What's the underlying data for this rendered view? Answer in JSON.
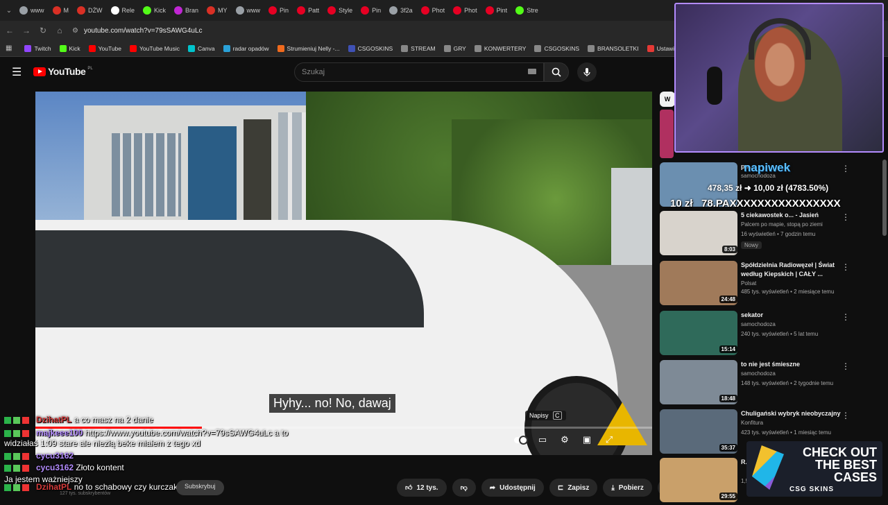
{
  "tabs": [
    {
      "label": "www",
      "color": "#9aa0a6"
    },
    {
      "label": "M",
      "color": "#d93025"
    },
    {
      "label": "DŻW",
      "color": "#d93025"
    },
    {
      "label": "Rele",
      "color": "#ffffff"
    },
    {
      "label": "Kick",
      "color": "#53fc18"
    },
    {
      "label": "Bran",
      "color": "#c026d3"
    },
    {
      "label": "MY",
      "color": "#d93025"
    },
    {
      "label": "www",
      "color": "#9aa0a6"
    },
    {
      "label": "Pin",
      "color": "#e60023"
    },
    {
      "label": "Patt",
      "color": "#e60023"
    },
    {
      "label": "Style",
      "color": "#e60023"
    },
    {
      "label": "Pin",
      "color": "#e60023"
    },
    {
      "label": "3f2a",
      "color": "#9aa0a6"
    },
    {
      "label": "Phot",
      "color": "#e60023"
    },
    {
      "label": "Phot",
      "color": "#e60023"
    },
    {
      "label": "Pint",
      "color": "#e60023"
    },
    {
      "label": "Stre",
      "color": "#53fc18"
    }
  ],
  "url": "youtube.com/watch?v=79sSAWG4uLc",
  "bookmarks": [
    {
      "label": "Twitch",
      "color": "#9146ff"
    },
    {
      "label": "Kick",
      "color": "#53fc18"
    },
    {
      "label": "YouTube",
      "color": "#ff0000"
    },
    {
      "label": "YouTube Music",
      "color": "#ff0000"
    },
    {
      "label": "Canva",
      "color": "#00c4cc"
    },
    {
      "label": "radar opadów",
      "color": "#2aa1d8"
    },
    {
      "label": "Strumieniuj Nelly -...",
      "color": "#f06a1d"
    },
    {
      "label": "CSGOSKINS",
      "color": "#3f51b5"
    },
    {
      "label": "STREAM",
      "color": "#888888"
    },
    {
      "label": "GRY",
      "color": "#888888"
    },
    {
      "label": "KONWERTERY",
      "color": "#888888"
    },
    {
      "label": "CSGOSKINS",
      "color": "#888888"
    },
    {
      "label": "BRANSOLETKI",
      "color": "#888888"
    },
    {
      "label": "Ustawienia strumien...",
      "color": "#e53935"
    }
  ],
  "yt": {
    "logo": "YouTube",
    "region": "PL",
    "search_placeholder": "Szukaj"
  },
  "video": {
    "subtitle": "Hyhy... no! No, dawaj",
    "captions_tooltip": "Napisy",
    "captions_key": "C",
    "progress": 0.27
  },
  "chat": [
    {
      "user": "DzihatPL",
      "user_color": "#d63b3b",
      "text": "a co masz na 2 danie"
    },
    {
      "user": "majkeee100",
      "user_color": "#b48cff",
      "text": "https://www.youtube.com/watch?v=79sSAWG4uLc a to"
    },
    {
      "user": "",
      "user_color": "#ffffff",
      "text": "widziałaś 1:09 stare ale niezłą beke miałem z tego xd"
    },
    {
      "user": "cycu3162",
      "user_color": "#b48cff",
      "text": ""
    },
    {
      "user": "cycu3162",
      "user_color": "#b48cff",
      "text": "Złoto kontent"
    },
    {
      "user": "",
      "user_color": "#ffffff",
      "text": "Ja jestem ważniejszy"
    },
    {
      "user": "DzihatPL",
      "user_color": "#d63b3b",
      "text": "no to schabowy czy kurczak"
    }
  ],
  "channel_behind": {
    "subs": "127 tys. subskrybentów",
    "subscribe": "Subskrybuj"
  },
  "actions": {
    "likes": "12 tys.",
    "share": "Udostępnij",
    "save": "Zapisz",
    "download": "Pobierz"
  },
  "sidebar": [
    {
      "title": "po...",
      "channel": "samochodoza",
      "meta": "",
      "duration": "",
      "color": "#6b8fb0",
      "new": ""
    },
    {
      "title": "5 ciekawostek o... - Jasień",
      "channel": "Palcem po mapie, stopą po ziemi",
      "meta": "16 wyświetleń • 7 godzin temu",
      "duration": "8:03",
      "color": "#d8d3cc",
      "new": "Nowy"
    },
    {
      "title": "Spółdzielnia Radiowęzeł | Świat według Kiepskich | CAŁY ...",
      "channel": "Polsat",
      "meta": "485 tys. wyświetleń • 2 miesiące temu",
      "duration": "24:48",
      "color": "#a07a5a",
      "new": ""
    },
    {
      "title": "sekator",
      "channel": "samochodoza",
      "meta": "240 tys. wyświetleń • 5 lat temu",
      "duration": "15:14",
      "color": "#2f6a5a",
      "new": ""
    },
    {
      "title": "to nie jest śmieszne",
      "channel": "samochodoza",
      "meta": "148 tys. wyświetleń • 2 tygodnie temu",
      "duration": "18:48",
      "color": "#7e8a96",
      "new": ""
    },
    {
      "title": "Chuligański wybryk nieobyczajny",
      "channel": "Konfitura",
      "meta": "423 tys. wyświetleń • 1 miesiąc temu",
      "duration": "35:37",
      "color": "#5a6a7a",
      "new": ""
    },
    {
      "title": "R...",
      "channel": "",
      "meta": "1,5 mln wyświetleń • 1 rok temu",
      "duration": "29:55",
      "color": "#c9a06a",
      "new": ""
    }
  ],
  "donation": {
    "name": "napiwek",
    "amount": "478,35 zł ➜ 10,00 zł (4783.50%)",
    "line": "10 zł   78.PAXXXXXXXXXXXXXXXX"
  },
  "promo": {
    "line1": "CHECK OUT",
    "line2": "THE BEST",
    "line3": "CASES",
    "brand": "CSG SKINS"
  }
}
